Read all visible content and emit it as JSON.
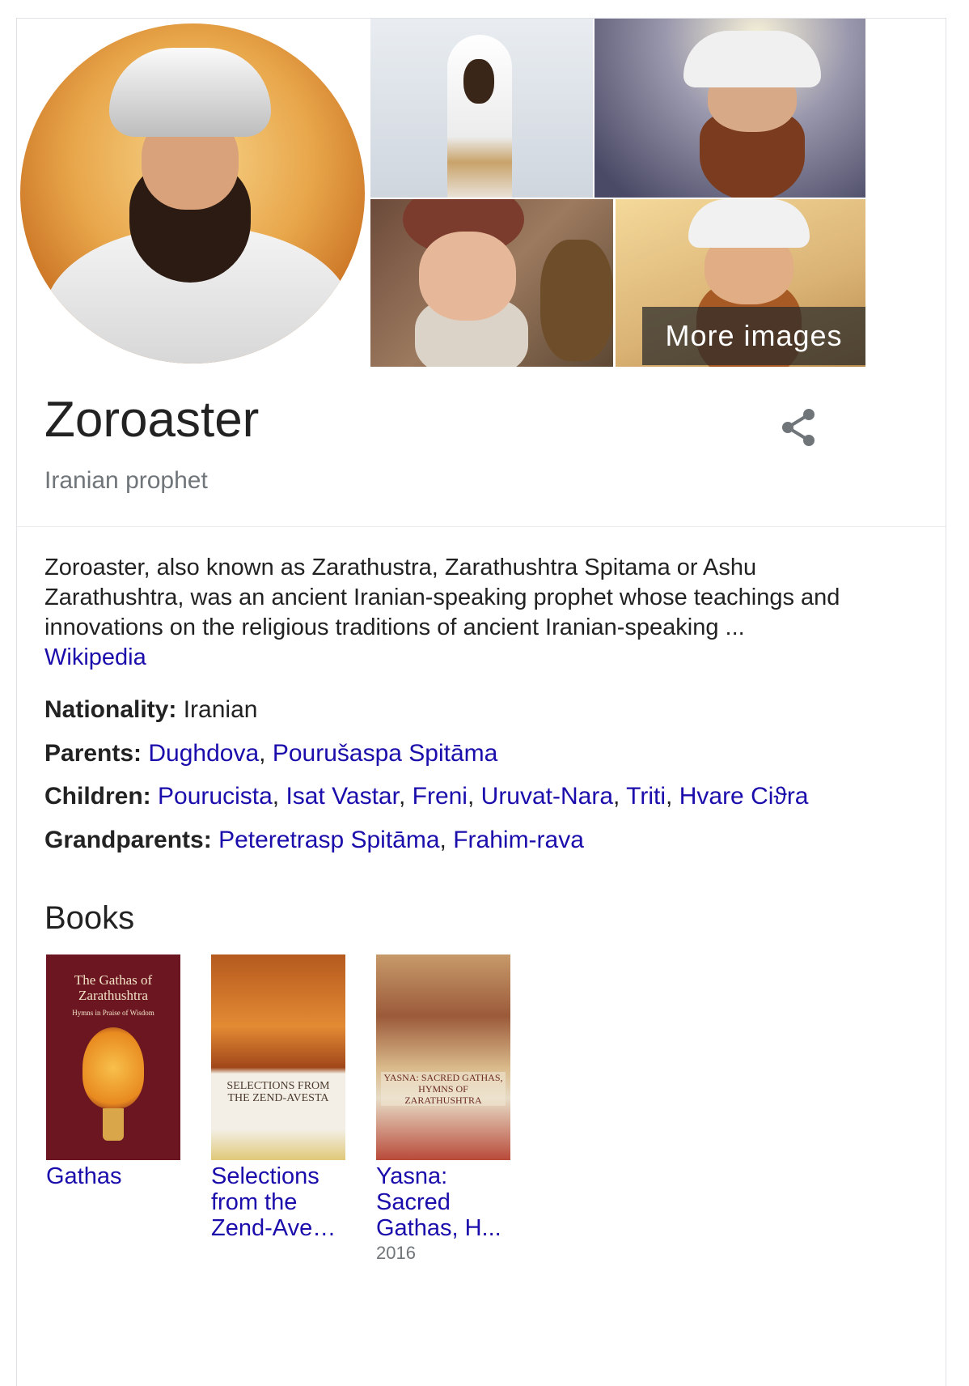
{
  "images": {
    "more_label": "More images"
  },
  "entity": {
    "name": "Zoroaster",
    "type": "Iranian prophet"
  },
  "description": {
    "text": "Zoroaster, also known as Zarathustra, Zarathushtra Spitama or Ashu Zarathushtra, was an ancient Iranian-speaking prophet whose teachings and innovations on the religious traditions of ancient Iranian-speaking ...",
    "source": "Wikipedia"
  },
  "facts": {
    "nationality": {
      "label": "Nationality:",
      "value": "Iranian"
    },
    "parents": {
      "label": "Parents:",
      "links": [
        "Dughdova",
        "Pourušaspa Spitāma"
      ]
    },
    "children": {
      "label": "Children:",
      "links": [
        "Pourucista",
        "Isat Vastar",
        "Freni",
        "Uruvat-Nara",
        "Triti",
        "Hvare Ciϑra"
      ]
    },
    "grandparents": {
      "label": "Grandparents:",
      "links": [
        "Peteretrasp Spitāma",
        "Frahim-rava"
      ]
    }
  },
  "books": {
    "heading": "Books",
    "items": [
      {
        "title": "Gathas",
        "cover_text": "The Gathas of Zarathushtra",
        "cover_sub": "Hymns in Praise of Wisdom",
        "year": ""
      },
      {
        "title": "Selections from the Zend-Ave…",
        "cover_text": "SELECTIONS FROM THE ZEND-AVESTA",
        "year": ""
      },
      {
        "title": "Yasna: Sacred Gathas, H...",
        "cover_text": "YASNA: SACRED GATHAS, HYMNS OF ZARATHUSHTRA",
        "year": "2016"
      }
    ]
  },
  "colors": {
    "link": "#1a0dab",
    "muted": "#70757a",
    "text": "#222222"
  },
  "icons": {
    "share": "share-icon"
  }
}
